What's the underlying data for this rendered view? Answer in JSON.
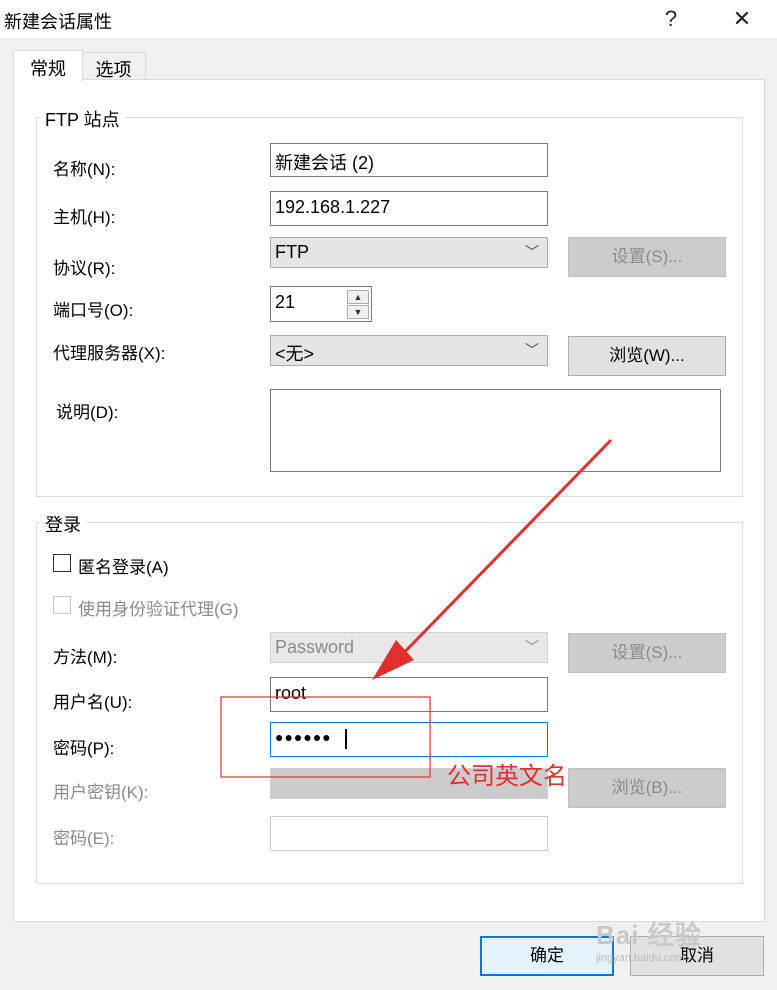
{
  "window": {
    "title": "新建会话属性",
    "help_symbol": "?",
    "close_symbol": "✕"
  },
  "tabs": [
    {
      "label": "常规",
      "active": true
    },
    {
      "label": "选项",
      "active": false
    }
  ],
  "ftp_site": {
    "group_title": "FTP 站点",
    "name_label": "名称(N):",
    "name_value": "新建会话 (2)",
    "host_label": "主机(H):",
    "host_value": "192.168.1.227",
    "protocol_label": "协议(R):",
    "protocol_value": "FTP",
    "protocol_settings_button": "设置(S)...",
    "port_label": "端口号(O):",
    "port_value": "21",
    "proxy_label": "代理服务器(X):",
    "proxy_value": "<无>",
    "browse_button": "浏览(W)...",
    "description_label": "说明(D):",
    "description_value": ""
  },
  "login": {
    "group_title": "登录",
    "anonymous_label": "匿名登录(A)",
    "auth_agent_label": "使用身份验证代理(G)",
    "method_label": "方法(M):",
    "method_value": "Password",
    "method_settings_button": "设置(S)...",
    "username_label": "用户名(U):",
    "username_value": "root",
    "password_label": "密码(P):",
    "password_value": "●●●●●●",
    "user_key_label": "用户密钥(K):",
    "user_key_browse_button": "浏览(B)...",
    "passphrase_label": "密码(E):"
  },
  "footer": {
    "ok_button": "确定",
    "cancel_button": "取消"
  },
  "annotation": {
    "text": "公司英文名",
    "color": "#e0302e"
  },
  "watermark": {
    "text": "Bai  经验",
    "subtext": "jingyan.baidu.com"
  },
  "colors": {
    "focus_border": "#0078d7",
    "annotation_red": "#e0302e"
  }
}
